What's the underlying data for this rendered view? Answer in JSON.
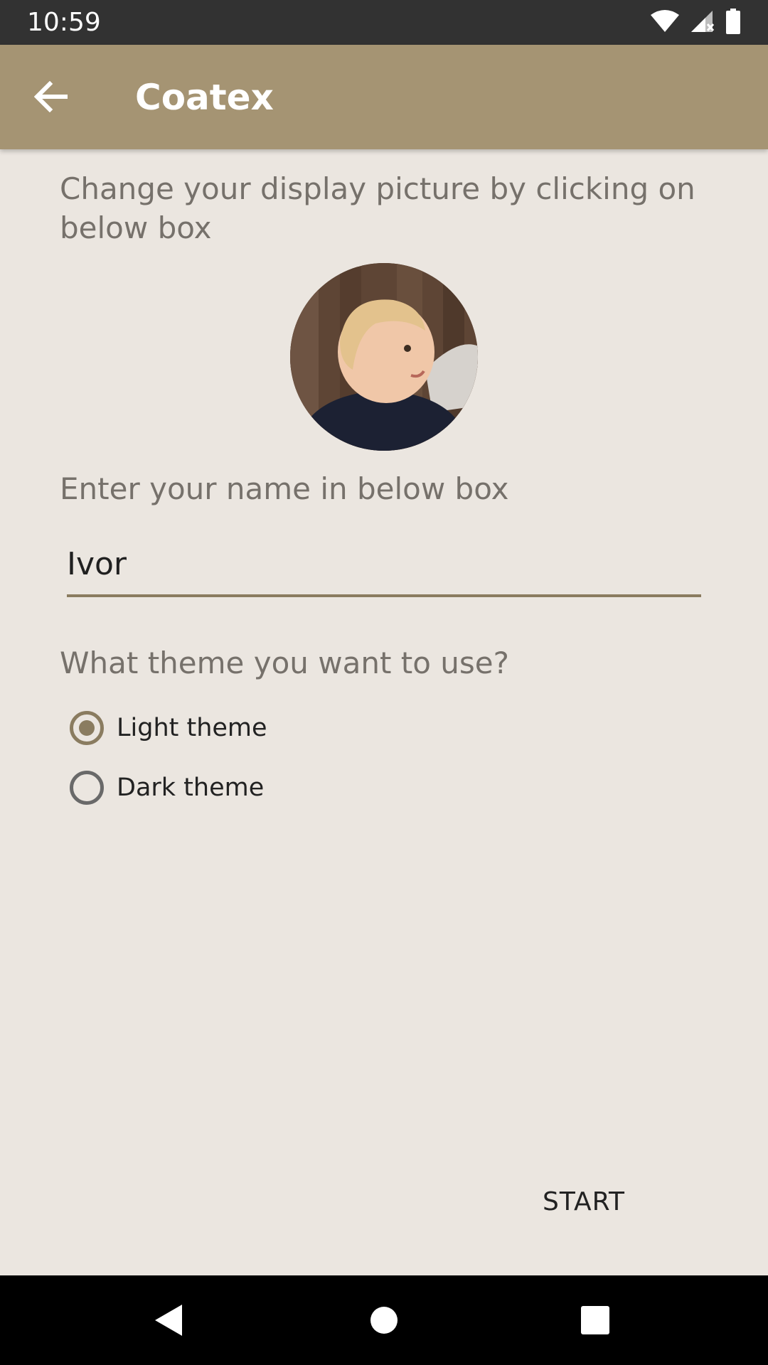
{
  "status_bar": {
    "time": "10:59",
    "icons": [
      "wifi-icon",
      "signal-icon",
      "battery-icon"
    ]
  },
  "app_bar": {
    "title": "Coatex",
    "back_icon": "arrow-left-icon",
    "background_color": "#a59473"
  },
  "profile": {
    "picture_prompt": "Change your display picture by clicking on below box",
    "name_prompt": "Enter your name in below box",
    "name_value": "Ivor",
    "theme_prompt": "What theme you want to use?",
    "theme_options": [
      {
        "label": "Light theme",
        "selected": true
      },
      {
        "label": "Dark theme",
        "selected": false
      }
    ],
    "start_label": "START"
  },
  "nav_bar": {
    "icons": [
      "back-triangle-icon",
      "home-circle-icon",
      "recents-square-icon"
    ]
  },
  "colors": {
    "accent": "#8a7c60",
    "page_background": "#ebe6e0"
  }
}
